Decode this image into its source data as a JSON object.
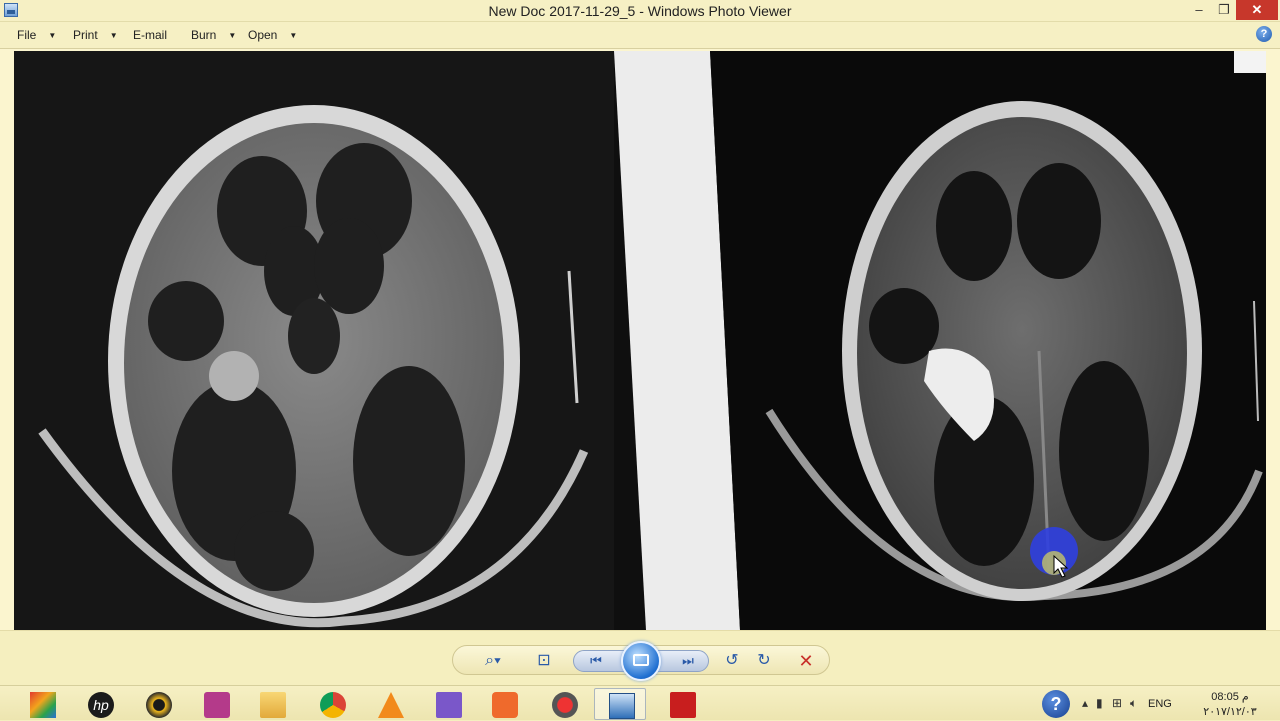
{
  "window": {
    "title": "New Doc 2017-11-29_5 - Windows Photo Viewer",
    "minimize_glyph": "–",
    "maximize_glyph": "❐",
    "close_glyph": "✕"
  },
  "menu": {
    "items": [
      {
        "label": "File",
        "has_dropdown": true
      },
      {
        "label": "Print",
        "has_dropdown": true
      },
      {
        "label": "E-mail",
        "has_dropdown": false
      },
      {
        "label": "Burn",
        "has_dropdown": true
      },
      {
        "label": "Open",
        "has_dropdown": true
      }
    ],
    "help_glyph": "?"
  },
  "photo": {
    "subject": "ct-scan-film",
    "overlay_colors": {
      "highlight_ring": "#2f3fe0",
      "cursor_glow": "#d9d65a"
    }
  },
  "controls": {
    "zoom_icon": "magnifier-icon",
    "fit_icon": "actual-size-icon",
    "prev_icon": "previous-icon",
    "slideshow_icon": "slideshow-icon",
    "next_icon": "next-icon",
    "rotate_left_icon": "rotate-counterclockwise-icon",
    "rotate_right_icon": "rotate-clockwise-icon",
    "delete_icon": "delete-icon"
  },
  "taskbar": {
    "apps": [
      "app-launcher-icon",
      "hp-icon",
      "media-player-icon",
      "presentation-icon",
      "file-explorer-icon",
      "chrome-icon",
      "vlc-icon",
      "visual-studio-icon",
      "video-icon",
      "download-manager-icon",
      "photo-viewer-icon",
      "pdf-reader-icon"
    ],
    "active_app": "photo-viewer-icon",
    "tray": {
      "help_glyph": "?",
      "language": "ENG",
      "time": "08:05 م",
      "date": "٢٠١٧/١٢/٠٣"
    }
  },
  "colors": {
    "chrome_bg": "#f6f0c4",
    "accent": "#2a5aa8",
    "close_red": "#c7372b"
  }
}
